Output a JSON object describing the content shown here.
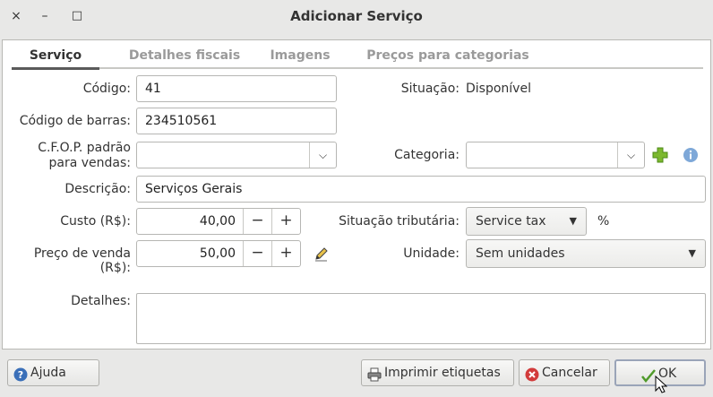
{
  "window": {
    "title": "Adicionar Serviço",
    "close_glyph": "×",
    "minimize_glyph": "–",
    "maximize_glyph": "□"
  },
  "tabs": [
    {
      "label": "Serviço",
      "active": true
    },
    {
      "label": "Detalhes fiscais",
      "active": false
    },
    {
      "label": "Imagens",
      "active": false
    },
    {
      "label": "Preços para categorias",
      "active": false
    }
  ],
  "form": {
    "codigo": {
      "label": "Código:",
      "value": "41"
    },
    "codigo_barras": {
      "label": "Código de barras:",
      "value": "234510561"
    },
    "cfop": {
      "label_line1": "C.F.O.P. padrão",
      "label_line2": "para vendas:",
      "value": ""
    },
    "descricao": {
      "label": "Descrição:",
      "value": "Serviços Gerais"
    },
    "custo": {
      "label": "Custo (R$):",
      "value": "40,00"
    },
    "preco_venda": {
      "label": "Preço de venda (R$):",
      "value": "50,00"
    },
    "detalhes": {
      "label": "Detalhes:",
      "value": ""
    },
    "situacao": {
      "label": "Situação:",
      "value": "Disponível"
    },
    "categoria": {
      "label": "Categoria:",
      "value": ""
    },
    "situacao_tributaria": {
      "label": "Situação tributária:",
      "value": "Service tax",
      "unit": "%"
    },
    "unidade": {
      "label": "Unidade:",
      "value": "Sem unidades"
    },
    "spin_minus": "−",
    "spin_plus": "+",
    "dropdown_arrow": "▼",
    "combo_arrow": "⌵"
  },
  "buttons": {
    "help": "Ajuda",
    "print": "Imprimir etiquetas",
    "cancel": "Cancelar",
    "ok": "OK"
  },
  "colors": {
    "add_icon": "#7cb82f",
    "info_icon": "#7ea8d8",
    "help_icon": "#3a6fb8",
    "cancel_icon": "#d23b3b",
    "ok_icon": "#4f9a2a"
  }
}
